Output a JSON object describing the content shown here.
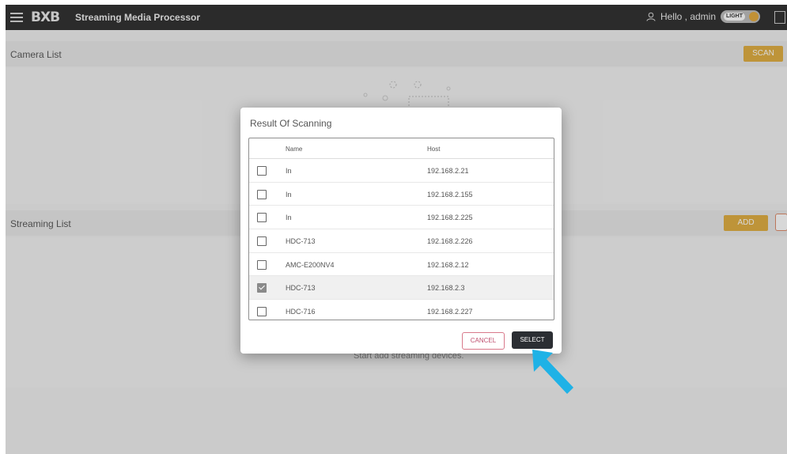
{
  "header": {
    "logo": "BXB",
    "title": "Streaming Media Processor",
    "greeting": "Hello , admin",
    "theme_toggle_label": "LIGHT",
    "menu_icon": "hamburger-icon",
    "user_icon": "user-icon"
  },
  "camera_section": {
    "title": "Camera List",
    "scan_label": "SCAN"
  },
  "streaming_section": {
    "title": "Streaming List",
    "add_label": "ADD",
    "empty_hint": "Start add streaming devices."
  },
  "dialog": {
    "title": "Result Of Scanning",
    "columns": {
      "name": "Name",
      "host": "Host"
    },
    "rows": [
      {
        "name": "In",
        "host": "192.168.2.21",
        "checked": false
      },
      {
        "name": "In",
        "host": "192.168.2.155",
        "checked": false
      },
      {
        "name": "In",
        "host": "192.168.2.225",
        "checked": false
      },
      {
        "name": "HDC-713",
        "host": "192.168.2.226",
        "checked": false
      },
      {
        "name": "AMC-E200NV4",
        "host": "192.168.2.12",
        "checked": false
      },
      {
        "name": "HDC-713",
        "host": "192.168.2.3",
        "checked": true
      },
      {
        "name": "HDC-716",
        "host": "192.168.2.227",
        "checked": false
      }
    ],
    "cancel_label": "CANCEL",
    "select_label": "SELECT"
  },
  "colors": {
    "topbar": "#2c2c2c",
    "accent_gold": "#e0ad3e",
    "select_button": "#2b2e33",
    "cancel_border": "#d8788a",
    "pointer_arrow": "#1fb2e6"
  }
}
